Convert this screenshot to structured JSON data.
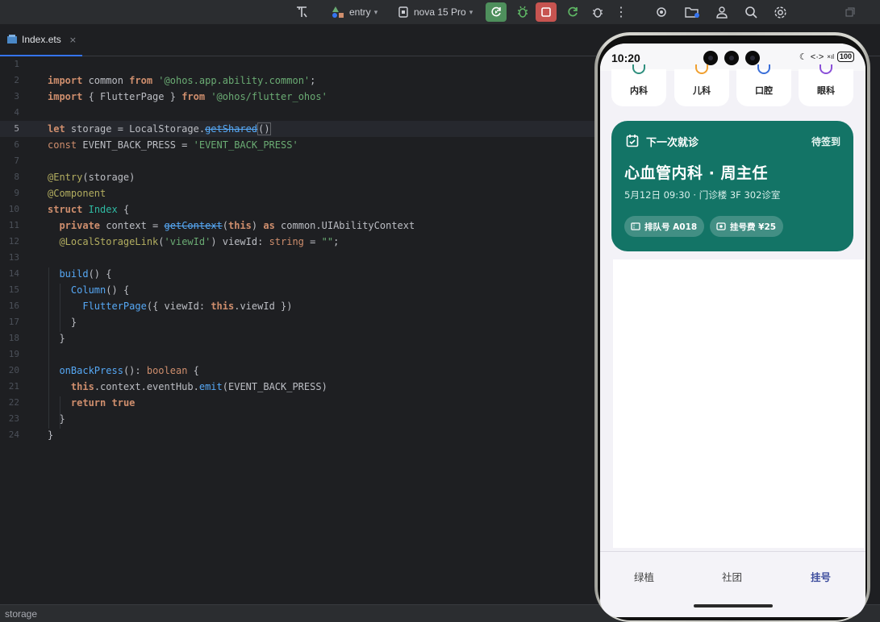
{
  "toolbar": {
    "module": "entry",
    "device": "nova 15 Pro",
    "icons": [
      "text-tool-icon",
      "module-icon",
      "device-icon",
      "run-refresh-icon",
      "debug-icon",
      "stop-icon",
      "apply-changes-icon",
      "profiler-icon",
      "more-icon",
      "locate-icon",
      "project-icon",
      "account-icon",
      "search-icon",
      "settings-icon",
      "restore-window-icon"
    ]
  },
  "tabs": [
    {
      "label": "Index.ets",
      "close": "×",
      "icon": "ets-file-icon"
    }
  ],
  "editor": {
    "line_numbers": [
      "1",
      "2",
      "3",
      "4",
      "5",
      "6",
      "7",
      "8",
      "9",
      "10",
      "11",
      "12",
      "13",
      "14",
      "15",
      "16",
      "17",
      "18",
      "19",
      "20",
      "21",
      "22",
      "23",
      "24"
    ],
    "current_line": 5
  },
  "status_bar": {
    "text": "storage"
  },
  "phone": {
    "time": "10:20",
    "signal": "<·>",
    "battery": "100",
    "departments": [
      {
        "label": "内科",
        "color": "#2f8f7e"
      },
      {
        "label": "儿科",
        "color": "#f0a030"
      },
      {
        "label": "口腔",
        "color": "#3b6fd8"
      },
      {
        "label": "眼科",
        "color": "#8a4fd8"
      }
    ],
    "appointment": {
      "header": "下一次就诊",
      "status": "待签到",
      "title": "心血管内科 · 周主任",
      "detail": "5月12日 09:30 · 门诊楼 3F 302诊室",
      "chips": [
        "排队号 A018",
        "挂号费 ¥25"
      ],
      "accent": "#137466"
    },
    "nav": [
      {
        "label": "绿植",
        "active": false
      },
      {
        "label": "社团",
        "active": false
      },
      {
        "label": "挂号",
        "active": true
      }
    ]
  }
}
